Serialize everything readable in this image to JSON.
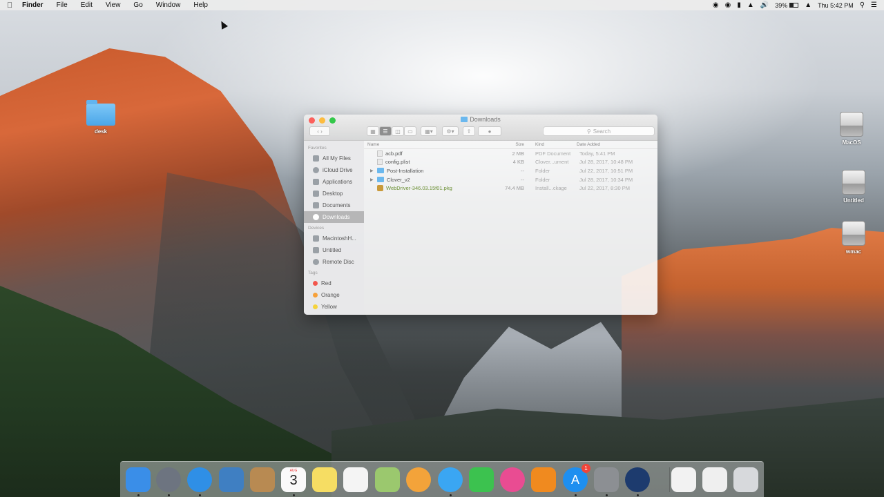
{
  "menubar": {
    "app": "Finder",
    "menus": [
      "File",
      "Edit",
      "View",
      "Go",
      "Window",
      "Help"
    ],
    "battery": "39%",
    "clock": "Thu 5:42 PM"
  },
  "desktop": {
    "icons": [
      {
        "label": "desk"
      },
      {
        "label": "MacOS"
      },
      {
        "label": "Untitled"
      },
      {
        "label": "wmac"
      }
    ]
  },
  "finder": {
    "title": "Downloads",
    "search_placeholder": "Search",
    "sidebar": {
      "favorites_head": "Favorites",
      "favorites": [
        "All My Files",
        "iCloud Drive",
        "Applications",
        "Desktop",
        "Documents",
        "Downloads"
      ],
      "devices_head": "Devices",
      "devices": [
        "MacintoshH...",
        "Untitled",
        "Remote Disc"
      ],
      "tags_head": "Tags",
      "tags": [
        {
          "label": "Red",
          "color": "#f2564d"
        },
        {
          "label": "Orange",
          "color": "#f7a13a"
        },
        {
          "label": "Yellow",
          "color": "#f5d33c"
        }
      ]
    },
    "columns": {
      "name": "Name",
      "size": "Size",
      "kind": "Kind",
      "date": "Date Added"
    },
    "files": [
      {
        "name": "acb.pdf",
        "size": "2 MB",
        "kind": "PDF Document",
        "date": "Today, 5:41 PM",
        "type": "file"
      },
      {
        "name": "config.plist",
        "size": "4 KB",
        "kind": "Clover...ument",
        "date": "Jul 28, 2017, 10:48 PM",
        "type": "file"
      },
      {
        "name": "Post-Installation",
        "size": "--",
        "kind": "Folder",
        "date": "Jul 22, 2017, 10:51 PM",
        "type": "folder"
      },
      {
        "name": "Clover_v2",
        "size": "--",
        "kind": "Folder",
        "date": "Jul 28, 2017, 10:34 PM",
        "type": "folder"
      },
      {
        "name": "WebDriver-346.03.15f01.pkg",
        "size": "74.4 MB",
        "kind": "Install...ckage",
        "date": "Jul 22, 2017, 8:30 PM",
        "type": "pkg"
      }
    ]
  },
  "dock": {
    "calendar_month": "AUG",
    "calendar_day": "3",
    "app_store_badge": "1",
    "apps": [
      {
        "name": "finder-icon",
        "color": "#3a8ee8"
      },
      {
        "name": "launchpad-icon",
        "color": "#6d7480"
      },
      {
        "name": "safari-icon",
        "color": "#2f8fe6"
      },
      {
        "name": "preview-icon",
        "color": "#3f7fc2"
      },
      {
        "name": "contacts-icon",
        "color": "#b88a52"
      },
      {
        "name": "calendar-icon",
        "color": "#fafafa"
      },
      {
        "name": "notes-icon",
        "color": "#f6dd63"
      },
      {
        "name": "reminders-icon",
        "color": "#f4f4f4"
      },
      {
        "name": "maps-icon",
        "color": "#9bc86e"
      },
      {
        "name": "photos-icon",
        "color": "#f3a33a"
      },
      {
        "name": "messages-icon",
        "color": "#3aa6f3"
      },
      {
        "name": "facetime-icon",
        "color": "#3cc24f"
      },
      {
        "name": "itunes-icon",
        "color": "#e94c92"
      },
      {
        "name": "ibooks-icon",
        "color": "#f08a1f"
      },
      {
        "name": "app-store-icon",
        "color": "#1e8ff0"
      },
      {
        "name": "system-preferences-icon",
        "color": "#8c8f93"
      },
      {
        "name": "quicktime-icon",
        "color": "#1d3b6e"
      },
      {
        "name": "document-icon",
        "color": "#f2f2f2"
      },
      {
        "name": "document-preview-icon",
        "color": "#efefef"
      },
      {
        "name": "trash-icon",
        "color": "#d7d9dc"
      }
    ]
  }
}
